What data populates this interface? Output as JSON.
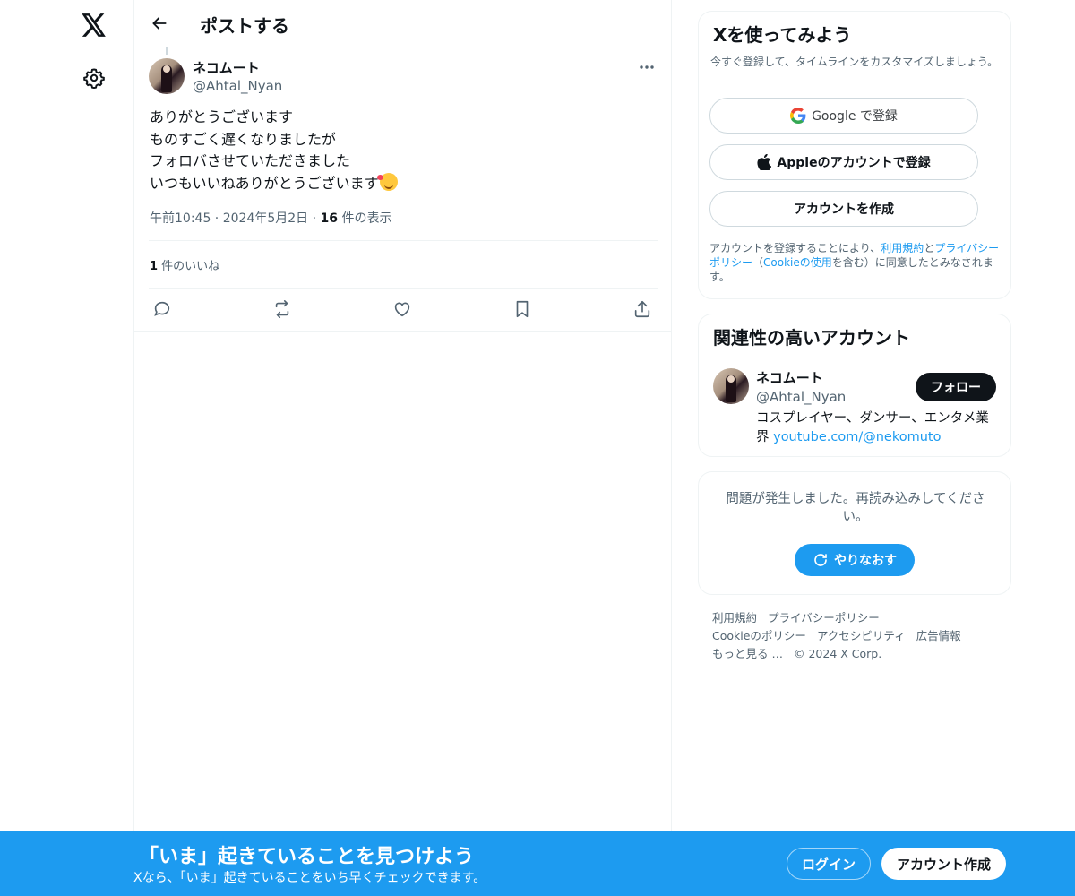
{
  "header": {
    "title": "ポストする"
  },
  "post": {
    "author_name": "ネコムート",
    "author_handle": "@Ahtal_Nyan",
    "lines": [
      "ありがとうございます",
      "ものすごく遅くなりましたが",
      "フォロバさせていただきました",
      "いつもいいねありがとうございます"
    ],
    "emoji": "smiling-face-with-hearts",
    "time": "午前10:45",
    "date": "2024年5月2日",
    "view_count": "16",
    "view_suffix": " 件の表示",
    "separator": " · ",
    "like_count": "1",
    "like_suffix": " 件のいいね"
  },
  "signup_card": {
    "title": "Xを使ってみよう",
    "subtitle": "今すぐ登録して、タイムラインをカスタマイズしましょう。",
    "google_label": "Google で登録",
    "apple_label": "Appleのアカウントで登録",
    "create_label": "アカウントを作成",
    "terms_prefix": "アカウントを登録することにより、",
    "terms_link": "利用規約",
    "terms_and": "と",
    "privacy_link": "プライバシーポリシー",
    "paren_open": "（",
    "cookie_link": "Cookieの使用",
    "terms_suffix": "を含む）に同意したとみなされます。"
  },
  "related_card": {
    "title": "関連性の高いアカウント",
    "name": "ネコムート",
    "handle": "@Ahtal_Nyan",
    "follow_label": "フォロー",
    "bio_text": "コスプレイヤー、ダンサー、エンタメ業界 ",
    "bio_link": "youtube.com/@nekomuto"
  },
  "error_card": {
    "message": "問題が発生しました。再読み込みしてください。",
    "retry_label": "やりなおす"
  },
  "footer": {
    "links": [
      "利用規約",
      "プライバシーポリシー",
      "Cookieのポリシー",
      "アクセシビリティ",
      "広告情報",
      "もっと見る …"
    ],
    "copyright": "© 2024 X Corp."
  },
  "bottom_bar": {
    "title": "「いま」起きていることを見つけよう",
    "subtitle": "Xなら、「いま」起きていることをいち早くチェックできます。",
    "login_label": "ログイン",
    "signup_label": "アカウント作成"
  },
  "colors": {
    "accent": "#1d9bf0",
    "text": "#0f1419",
    "muted": "#536471",
    "border": "#eff3f4"
  }
}
